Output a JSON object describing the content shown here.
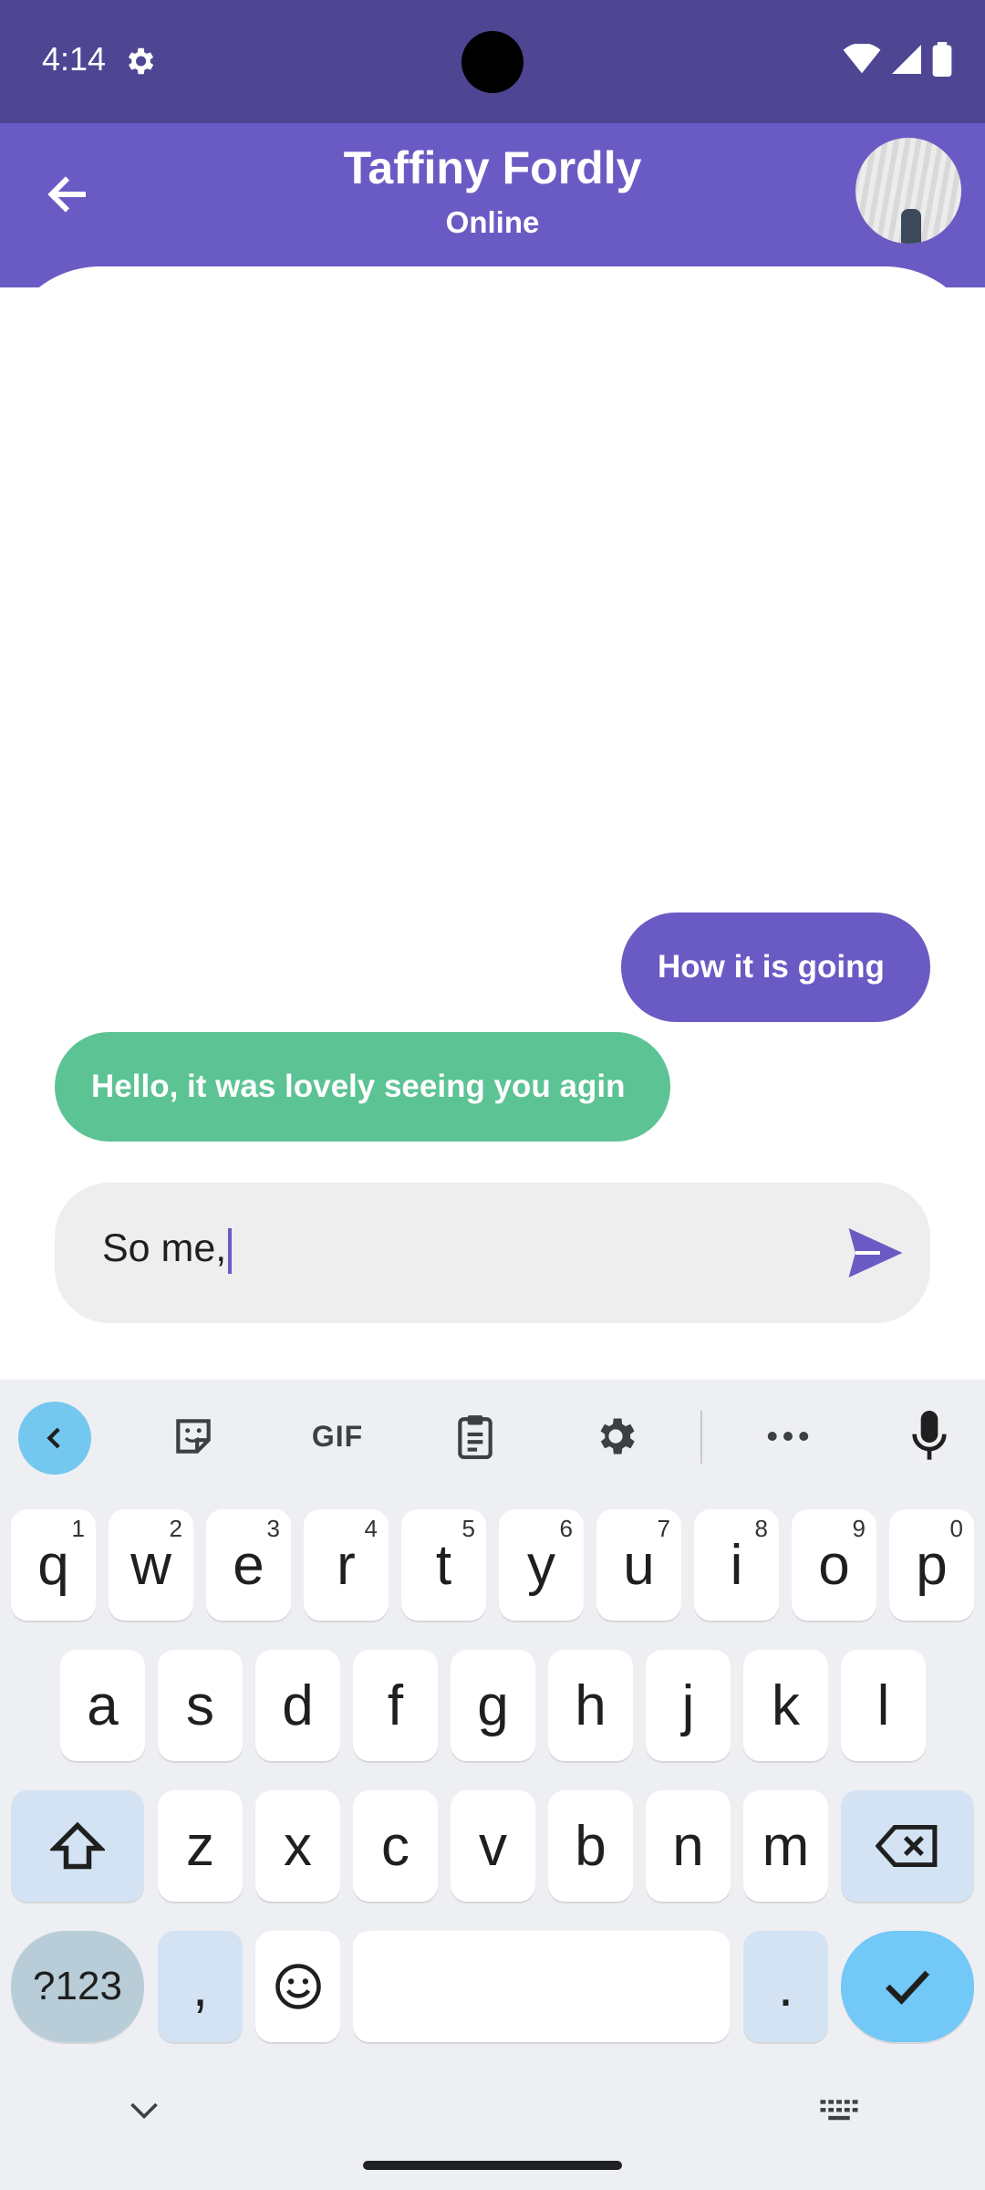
{
  "status_bar": {
    "time": "4:14"
  },
  "header": {
    "title": "Taffiny Fordly",
    "subtitle": "Online"
  },
  "messages": [
    {
      "direction": "outgoing",
      "text": "How it is going"
    },
    {
      "direction": "incoming",
      "text": "Hello, it was lovely seeing you agin"
    }
  ],
  "composer": {
    "value": "So me,"
  },
  "keyboard": {
    "toolbar": [
      "collapse-icon",
      "sticker-icon",
      "GIF",
      "clipboard-icon",
      "settings-icon",
      "more-icon",
      "mic-icon"
    ],
    "row1": [
      {
        "k": "q",
        "h": "1"
      },
      {
        "k": "w",
        "h": "2"
      },
      {
        "k": "e",
        "h": "3"
      },
      {
        "k": "r",
        "h": "4"
      },
      {
        "k": "t",
        "h": "5"
      },
      {
        "k": "y",
        "h": "6"
      },
      {
        "k": "u",
        "h": "7"
      },
      {
        "k": "i",
        "h": "8"
      },
      {
        "k": "o",
        "h": "9"
      },
      {
        "k": "p",
        "h": "0"
      }
    ],
    "row2": [
      "a",
      "s",
      "d",
      "f",
      "g",
      "h",
      "j",
      "k",
      "l"
    ],
    "row3": [
      "z",
      "x",
      "c",
      "v",
      "b",
      "n",
      "m"
    ],
    "symbols": "?123",
    "comma": ",",
    "period": "."
  },
  "colors": {
    "accent": "#6a5bc4",
    "status_bar": "#4e4593",
    "incoming": "#5cc394",
    "enter": "#72c8f6"
  }
}
